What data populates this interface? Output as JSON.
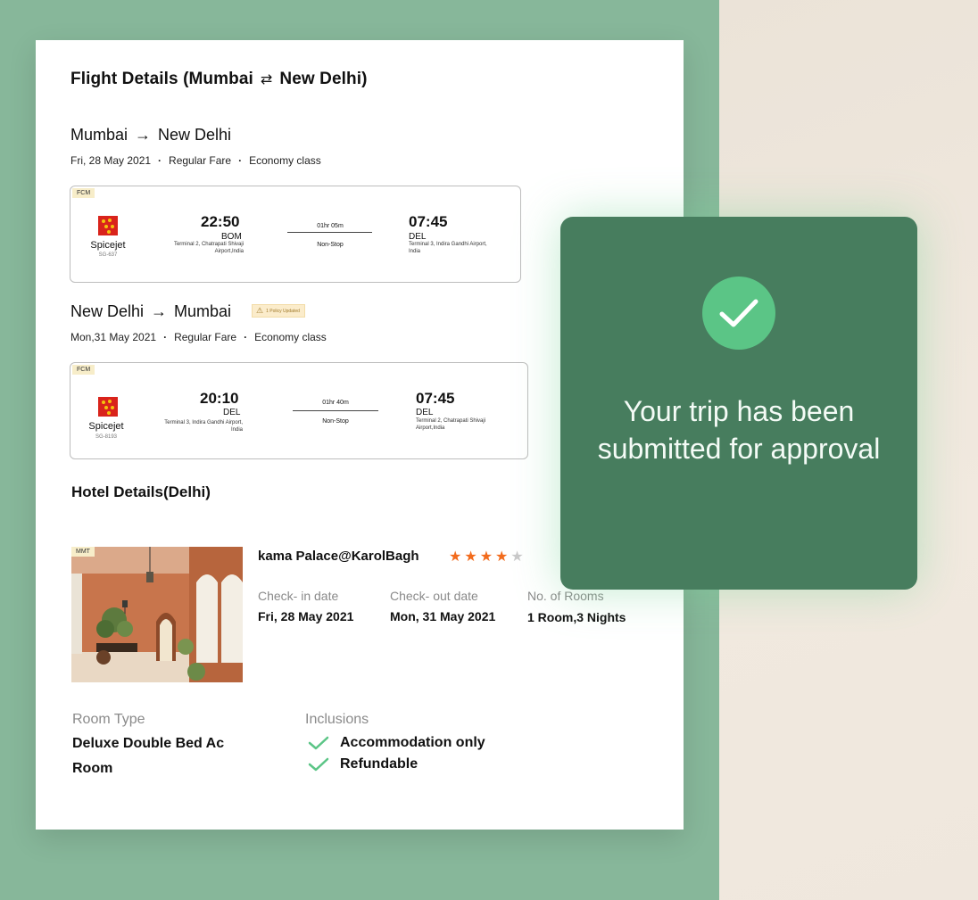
{
  "flight_section": {
    "title_from": "Flight Details (Mumbai",
    "title_swap_icon": "swap-arrows-icon",
    "title_to": "New Delhi)",
    "outbound": {
      "from_city": "Mumbai",
      "to_city": "New Delhi",
      "date": "Fri, 28 May 2021",
      "fare": "Regular Fare",
      "cabin": "Economy class",
      "vendor": "FCM",
      "airline": "Spicejet",
      "flight_no": "SG-637",
      "dep_time": "22:50",
      "dep_code": "BOM",
      "dep_terminal": "Terminal 2, Chatrapati Shivaji Airport,India",
      "duration": "01hr 05m",
      "stops": "Non-Stop",
      "arr_time": "07:45",
      "arr_code": "DEL",
      "arr_terminal": "Terminal 3, Indira Gandhi Airport, India"
    },
    "return": {
      "from_city": "New Delhi",
      "to_city": "Mumbai",
      "policy_badge": "1 Policy Updated",
      "date": "Mon,31 May 2021",
      "fare": "Regular Fare",
      "cabin": "Economy class",
      "vendor": "FCM",
      "airline": "Spicejet",
      "flight_no": "SG-8193",
      "dep_time": "20:10",
      "dep_code": "DEL",
      "dep_terminal": "Terminal 3, Indira Gandhi Airport, India",
      "duration": "01hr 40m",
      "stops": "Non-Stop",
      "arr_time": "07:45",
      "arr_code": "DEL",
      "arr_terminal": "Terminal 2, Chatrapati Shivaji Airport,India"
    }
  },
  "hotel_section": {
    "title": "Hotel Details(Delhi)",
    "vendor": "MMT",
    "name": "kama Palace@KarolBagh",
    "stars_filled": 4,
    "stars_total": 5,
    "checkin_label": "Check- in date",
    "checkin_value": "Fri, 28 May 2021",
    "checkout_label": "Check- out date",
    "checkout_value": "Mon, 31 May 2021",
    "rooms_label": "No. of  Rooms",
    "rooms_value": "1 Room,3 Nights",
    "room_type_label": "Room Type",
    "room_type_line1": "Deluxe Double Bed Ac",
    "room_type_line2": "Room",
    "inclusions_label": "Inclusions",
    "inclusions": [
      "Accommodation only",
      "Refundable"
    ]
  },
  "confirmation": {
    "line1": "Your trip has been",
    "line2": "submitted for approval",
    "icon": "check-circle-icon"
  },
  "colors": {
    "background_green": "#87b79a",
    "modal_green": "#477d5e",
    "check_green": "#5bc586",
    "star_orange": "#f26b1d",
    "airline_red": "#d9231b"
  }
}
